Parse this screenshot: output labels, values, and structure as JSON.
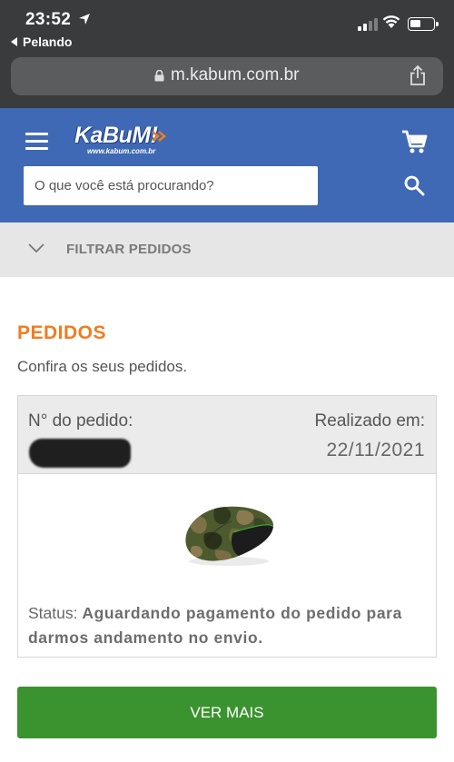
{
  "status_bar": {
    "time": "23:52",
    "back_app": "Pelando"
  },
  "browser": {
    "url": "m.kabum.com.br"
  },
  "header": {
    "logo_text": "KaBuM!",
    "logo_subtext": "www.kabum.com.br",
    "search_placeholder": "O que você está procurando?",
    "brand_color": "#3f69b5"
  },
  "filter": {
    "label": "FILTRAR PEDIDOS"
  },
  "main": {
    "title": "PEDIDOS",
    "subtitle": "Confira os seus pedidos.",
    "accent_color": "#f07c22"
  },
  "order": {
    "number_label": "N° do pedido:",
    "date_label": "Realizado em:",
    "date": "22/11/2021",
    "product_icon": "camo-mouse-image",
    "status_label": "Status:",
    "status_text": "Aguardando pagamento do pedido para darmos andamento no envio."
  },
  "actions": {
    "ver_mais_label": "VER MAIS",
    "button_color": "#3a932e"
  }
}
